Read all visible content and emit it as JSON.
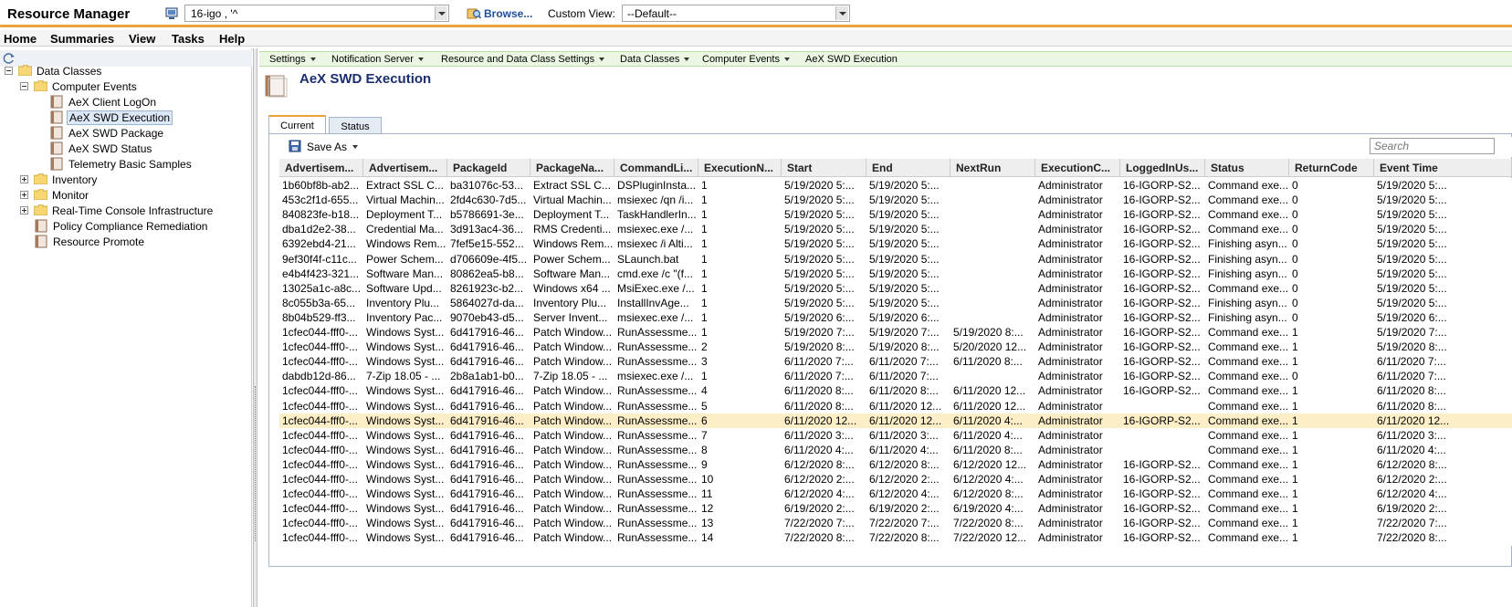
{
  "app": {
    "title": "Resource Manager"
  },
  "toolbar": {
    "computer_value": "16-igo ,   '^",
    "browse_label": "Browse...",
    "custom_view_label": "Custom View:",
    "custom_view_value": "--Default--"
  },
  "menu": [
    "Home",
    "Summaries",
    "View",
    "Tasks",
    "Help"
  ],
  "tree": {
    "data_classes": "Data Classes",
    "computer_events": "Computer Events",
    "leaves": [
      "AeX Client LogOn",
      "AeX SWD Execution",
      "AeX SWD Package",
      "AeX SWD Status",
      "Telemetry Basic Samples"
    ],
    "inventory": "Inventory",
    "monitor": "Monitor",
    "rtci": "Real-Time Console Infrastructure",
    "policy": "Policy Compliance Remediation",
    "promote": "Resource Promote"
  },
  "breadcrumb": [
    "Settings",
    "Notification Server",
    "Resource and Data Class Settings",
    "Data Classes",
    "Computer Events",
    "AeX SWD Execution"
  ],
  "page": {
    "title": "AeX SWD Execution"
  },
  "tabs": [
    "Current",
    "Status"
  ],
  "grid": {
    "save_as": "Save As",
    "search_placeholder": "Search",
    "columns": [
      "Advertisem...",
      "Advertisem...",
      "PackageId",
      "PackageNa...",
      "CommandLi...",
      "ExecutionN...",
      "Start",
      "End",
      "NextRun",
      "ExecutionC...",
      "LoggedInUs...",
      "Status",
      "ReturnCode",
      "Event Time"
    ],
    "rows": [
      [
        "1b60bf8b-ab2...",
        "Extract SSL C...",
        "ba31076c-53...",
        "Extract SSL C...",
        "DSPluginInsta...",
        "1",
        "5/19/2020 5:...",
        "5/19/2020 5:...",
        "",
        "Administrator",
        "16-IGORP-S2...",
        "Command exe...",
        "0",
        "5/19/2020 5:..."
      ],
      [
        "453c2f1d-655...",
        "Virtual Machin...",
        "2fd4c630-7d5...",
        "Virtual Machin...",
        "msiexec /qn /i...",
        "1",
        "5/19/2020 5:...",
        "5/19/2020 5:...",
        "",
        "Administrator",
        "16-IGORP-S2...",
        "Command exe...",
        "0",
        "5/19/2020 5:..."
      ],
      [
        "840823fe-b18...",
        "Deployment T...",
        "b5786691-3e...",
        "Deployment T...",
        "TaskHandlerIn...",
        "1",
        "5/19/2020 5:...",
        "5/19/2020 5:...",
        "",
        "Administrator",
        "16-IGORP-S2...",
        "Command exe...",
        "0",
        "5/19/2020 5:..."
      ],
      [
        "dba1d2e2-38...",
        "Credential Ma...",
        "3d913ac4-36...",
        "RMS Credenti...",
        "msiexec.exe /...",
        "1",
        "5/19/2020 5:...",
        "5/19/2020 5:...",
        "",
        "Administrator",
        "16-IGORP-S2...",
        "Command exe...",
        "0",
        "5/19/2020 5:..."
      ],
      [
        "6392ebd4-21...",
        "Windows Rem...",
        "7fef5e15-552...",
        "Windows Rem...",
        "msiexec /i Alti...",
        "1",
        "5/19/2020 5:...",
        "5/19/2020 5:...",
        "",
        "Administrator",
        "16-IGORP-S2...",
        "Finishing asyn...",
        "0",
        "5/19/2020 5:..."
      ],
      [
        "9ef30f4f-c11c...",
        "Power Schem...",
        "d706609e-4f5...",
        "Power Schem...",
        "SLaunch.bat",
        "1",
        "5/19/2020 5:...",
        "5/19/2020 5:...",
        "",
        "Administrator",
        "16-IGORP-S2...",
        "Finishing asyn...",
        "0",
        "5/19/2020 5:..."
      ],
      [
        "e4b4f423-321...",
        "Software Man...",
        "80862ea5-b8...",
        "Software Man...",
        "cmd.exe /c \"(f...",
        "1",
        "5/19/2020 5:...",
        "5/19/2020 5:...",
        "",
        "Administrator",
        "16-IGORP-S2...",
        "Finishing asyn...",
        "0",
        "5/19/2020 5:..."
      ],
      [
        "13025a1c-a8c...",
        "Software Upd...",
        "8261923c-b2...",
        "Windows x64 ...",
        "MsiExec.exe /...",
        "1",
        "5/19/2020 5:...",
        "5/19/2020 5:...",
        "",
        "Administrator",
        "16-IGORP-S2...",
        "Command exe...",
        "0",
        "5/19/2020 5:..."
      ],
      [
        "8c055b3a-65...",
        "Inventory Plu...",
        "5864027d-da...",
        "Inventory Plu...",
        "InstallInvAge...",
        "1",
        "5/19/2020 5:...",
        "5/19/2020 5:...",
        "",
        "Administrator",
        "16-IGORP-S2...",
        "Finishing asyn...",
        "0",
        "5/19/2020 5:..."
      ],
      [
        "8b04b529-ff3...",
        "Inventory Pac...",
        "9070eb43-d5...",
        "Server Invent...",
        "msiexec.exe /...",
        "1",
        "5/19/2020 6:...",
        "5/19/2020 6:...",
        "",
        "Administrator",
        "16-IGORP-S2...",
        "Finishing asyn...",
        "0",
        "5/19/2020 6:..."
      ],
      [
        "1cfec044-fff0-...",
        "Windows Syst...",
        "6d417916-46...",
        "Patch Window...",
        "RunAssessme...",
        "1",
        "5/19/2020 7:...",
        "5/19/2020 7:...",
        "5/19/2020 8:...",
        "Administrator",
        "16-IGORP-S2...",
        "Command exe...",
        "1",
        "5/19/2020 7:..."
      ],
      [
        "1cfec044-fff0-...",
        "Windows Syst...",
        "6d417916-46...",
        "Patch Window...",
        "RunAssessme...",
        "2",
        "5/19/2020 8:...",
        "5/19/2020 8:...",
        "5/20/2020 12...",
        "Administrator",
        "16-IGORP-S2...",
        "Command exe...",
        "1",
        "5/19/2020 8:..."
      ],
      [
        "1cfec044-fff0-...",
        "Windows Syst...",
        "6d417916-46...",
        "Patch Window...",
        "RunAssessme...",
        "3",
        "6/11/2020 7:...",
        "6/11/2020 7:...",
        "6/11/2020 8:...",
        "Administrator",
        "16-IGORP-S2...",
        "Command exe...",
        "1",
        "6/11/2020 7:..."
      ],
      [
        "dabdb12d-86...",
        "7-Zip 18.05 - ...",
        "2b8a1ab1-b0...",
        "7-Zip 18.05 - ...",
        "msiexec.exe /...",
        "1",
        "6/11/2020 7:...",
        "6/11/2020 7:...",
        "",
        "Administrator",
        "16-IGORP-S2...",
        "Command exe...",
        "0",
        "6/11/2020 7:..."
      ],
      [
        "1cfec044-fff0-...",
        "Windows Syst...",
        "6d417916-46...",
        "Patch Window...",
        "RunAssessme...",
        "4",
        "6/11/2020 8:...",
        "6/11/2020 8:...",
        "6/11/2020 12...",
        "Administrator",
        "16-IGORP-S2...",
        "Command exe...",
        "1",
        "6/11/2020 8:..."
      ],
      [
        "1cfec044-fff0-...",
        "Windows Syst...",
        "6d417916-46...",
        "Patch Window...",
        "RunAssessme...",
        "5",
        "6/11/2020 8:...",
        "6/11/2020 12...",
        "6/11/2020 12...",
        "Administrator",
        "",
        "Command exe...",
        "1",
        "6/11/2020 8:..."
      ],
      [
        "1cfec044-fff0-...",
        "Windows Syst...",
        "6d417916-46...",
        "Patch Window...",
        "RunAssessme...",
        "6",
        "6/11/2020 12...",
        "6/11/2020 12...",
        "6/11/2020 4:...",
        "Administrator",
        "16-IGORP-S2...",
        "Command exe...",
        "1",
        "6/11/2020 12..."
      ],
      [
        "1cfec044-fff0-...",
        "Windows Syst...",
        "6d417916-46...",
        "Patch Window...",
        "RunAssessme...",
        "7",
        "6/11/2020 3:...",
        "6/11/2020 3:...",
        "6/11/2020 4:...",
        "Administrator",
        "",
        "Command exe...",
        "1",
        "6/11/2020 3:..."
      ],
      [
        "1cfec044-fff0-...",
        "Windows Syst...",
        "6d417916-46...",
        "Patch Window...",
        "RunAssessme...",
        "8",
        "6/11/2020 4:...",
        "6/11/2020 4:...",
        "6/11/2020 8:...",
        "Administrator",
        "",
        "Command exe...",
        "1",
        "6/11/2020 4:..."
      ],
      [
        "1cfec044-fff0-...",
        "Windows Syst...",
        "6d417916-46...",
        "Patch Window...",
        "RunAssessme...",
        "9",
        "6/12/2020 8:...",
        "6/12/2020 8:...",
        "6/12/2020 12...",
        "Administrator",
        "16-IGORP-S2...",
        "Command exe...",
        "1",
        "6/12/2020 8:..."
      ],
      [
        "1cfec044-fff0-...",
        "Windows Syst...",
        "6d417916-46...",
        "Patch Window...",
        "RunAssessme...",
        "10",
        "6/12/2020 2:...",
        "6/12/2020 2:...",
        "6/12/2020 4:...",
        "Administrator",
        "16-IGORP-S2...",
        "Command exe...",
        "1",
        "6/12/2020 2:..."
      ],
      [
        "1cfec044-fff0-...",
        "Windows Syst...",
        "6d417916-46...",
        "Patch Window...",
        "RunAssessme...",
        "11",
        "6/12/2020 4:...",
        "6/12/2020 4:...",
        "6/12/2020 8:...",
        "Administrator",
        "16-IGORP-S2...",
        "Command exe...",
        "1",
        "6/12/2020 4:..."
      ],
      [
        "1cfec044-fff0-...",
        "Windows Syst...",
        "6d417916-46...",
        "Patch Window...",
        "RunAssessme...",
        "12",
        "6/19/2020 2:...",
        "6/19/2020 2:...",
        "6/19/2020 4:...",
        "Administrator",
        "16-IGORP-S2...",
        "Command exe...",
        "1",
        "6/19/2020 2:..."
      ],
      [
        "1cfec044-fff0-...",
        "Windows Syst...",
        "6d417916-46...",
        "Patch Window...",
        "RunAssessme...",
        "13",
        "7/22/2020 7:...",
        "7/22/2020 7:...",
        "7/22/2020 8:...",
        "Administrator",
        "16-IGORP-S2...",
        "Command exe...",
        "1",
        "7/22/2020 7:..."
      ],
      [
        "1cfec044-fff0-...",
        "Windows Syst...",
        "6d417916-46...",
        "Patch Window...",
        "RunAssessme...",
        "14",
        "7/22/2020 8:...",
        "7/22/2020 8:...",
        "7/22/2020 12...",
        "Administrator",
        "16-IGORP-S2...",
        "Command exe...",
        "1",
        "7/22/2020 8:..."
      ]
    ]
  }
}
